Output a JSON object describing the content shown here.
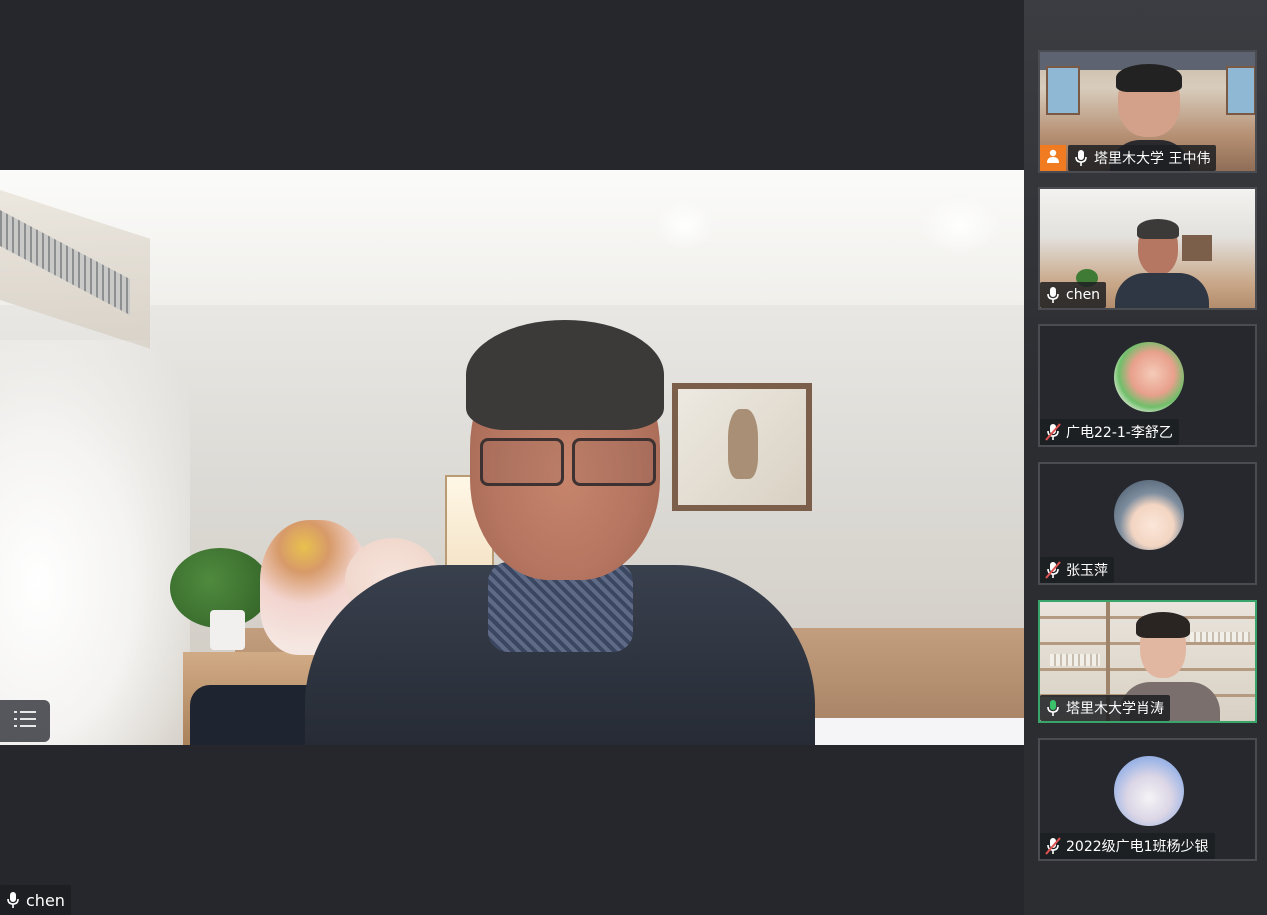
{
  "main_speaker": {
    "name": "chen"
  },
  "participants": [
    {
      "name": "塔里木大学 王中伟",
      "mic": "on",
      "video": "on",
      "badge": "person-icon",
      "active": false
    },
    {
      "name": "chen",
      "mic": "on",
      "video": "on",
      "active": false
    },
    {
      "name": "广电22-1-李舒乙",
      "mic": "muted",
      "video": "off",
      "active": false
    },
    {
      "name": "张玉萍",
      "mic": "muted",
      "video": "off",
      "active": false
    },
    {
      "name": "塔里木大学肖涛",
      "mic": "speaking",
      "video": "on",
      "active": true
    },
    {
      "name": "2022级广电1班杨少银",
      "mic": "muted",
      "video": "off",
      "active": false
    }
  ],
  "icons": {
    "menu": "list-menu-icon",
    "mic": "microphone-icon",
    "mic_muted": "microphone-muted-icon",
    "host": "person-icon"
  },
  "colors": {
    "background": "#25272c",
    "sidebar": "#2b2d31",
    "active_speaker_border": "#3aa56a",
    "host_badge": "#f07b20",
    "muted": "#e05252",
    "speaking": "#3ac36a"
  }
}
